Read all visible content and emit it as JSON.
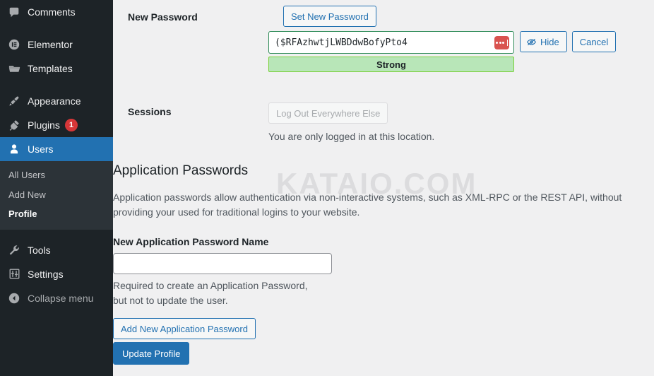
{
  "sidebar": {
    "items": [
      {
        "label": "Comments",
        "icon": "comments-icon",
        "active": false
      },
      {
        "label": "Elementor",
        "icon": "elementor-icon",
        "active": false
      },
      {
        "label": "Templates",
        "icon": "templates-folder-icon",
        "active": false
      },
      {
        "label": "Appearance",
        "icon": "appearance-brush-icon",
        "active": false
      },
      {
        "label": "Plugins",
        "icon": "plugins-plug-icon",
        "badge": "1",
        "active": false
      },
      {
        "label": "Users",
        "icon": "users-person-icon",
        "active": true
      },
      {
        "label": "Tools",
        "icon": "tools-wrench-icon",
        "active": false
      },
      {
        "label": "Settings",
        "icon": "settings-sliders-icon",
        "active": false
      },
      {
        "label": "Collapse menu",
        "icon": "collapse-arrow-icon",
        "active": false
      }
    ],
    "submenu": [
      {
        "label": "All Users",
        "current": false
      },
      {
        "label": "Add New",
        "current": false
      },
      {
        "label": "Profile",
        "current": true
      }
    ]
  },
  "new_password": {
    "label": "New Password",
    "set_button": "Set New Password",
    "value": "($RFAzhwtjLWBDdwBofyPto4",
    "strength": "Strong",
    "hide_button": "Hide",
    "cancel_button": "Cancel",
    "manager_icon": "password-manager-icon",
    "eye_icon": "eye-slash-icon",
    "strength_color": "#b8e6b8",
    "strength_border": "#7ad03a"
  },
  "sessions": {
    "label": "Sessions",
    "logout_button": "Log Out Everywhere Else",
    "note": "You are only logged in at this location."
  },
  "application_passwords": {
    "heading": "Application Passwords",
    "description": "Application passwords allow authentication via non-interactive systems, such as XML-RPC or the REST API, without providing your used for traditional logins to your website.",
    "name_label": "New Application Password Name",
    "name_value": "",
    "name_placeholder": "",
    "help": "Required to create an Application Password, but not to update the user.",
    "add_button": "Add New Application Password"
  },
  "footer": {
    "update_button": "Update Profile"
  },
  "watermark": "KATAIO.COM",
  "colors": {
    "accent": "#2271b1",
    "sidebar_bg": "#1d2327",
    "submenu_bg": "#2c3338",
    "badge": "#d63638",
    "page_bg": "#f0f0f1"
  }
}
